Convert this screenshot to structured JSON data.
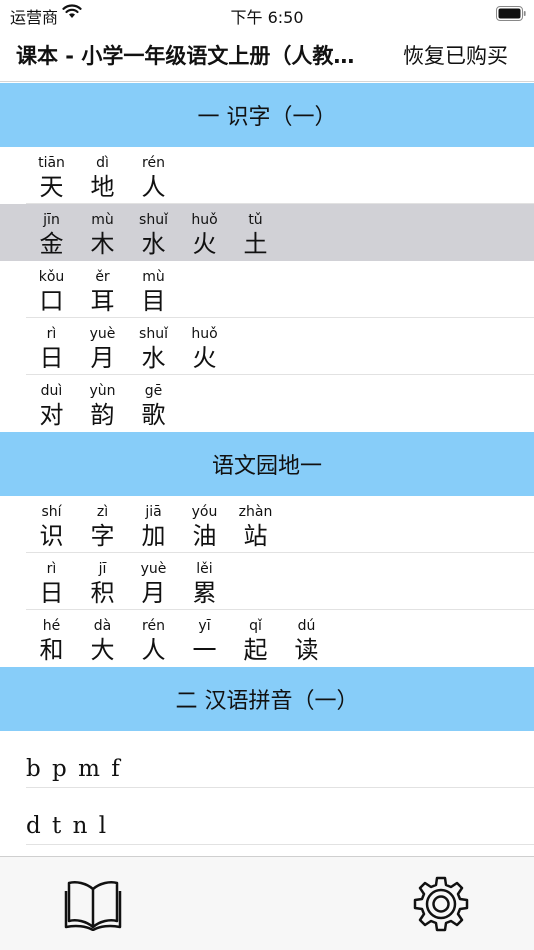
{
  "status_bar": {
    "carrier": "运营商",
    "time": "下午 6:50"
  },
  "nav": {
    "title": "课本 - 小学一年级语文上册（人教…",
    "restore_label": "恢复已购买"
  },
  "sections": [
    {
      "title": "一 识字（一）",
      "rows": [
        [
          {
            "p": "tiān",
            "c": "天"
          },
          {
            "p": "dì",
            "c": "地"
          },
          {
            "p": "rén",
            "c": "人"
          }
        ],
        [
          {
            "p": "jīn",
            "c": "金"
          },
          {
            "p": "mù",
            "c": "木"
          },
          {
            "p": "shuǐ",
            "c": "水"
          },
          {
            "p": "huǒ",
            "c": "火"
          },
          {
            "p": "tǔ",
            "c": "土"
          }
        ],
        [
          {
            "p": "kǒu",
            "c": "口"
          },
          {
            "p": "ěr",
            "c": "耳"
          },
          {
            "p": "mù",
            "c": "目"
          }
        ],
        [
          {
            "p": "rì",
            "c": "日"
          },
          {
            "p": "yuè",
            "c": "月"
          },
          {
            "p": "shuǐ",
            "c": "水"
          },
          {
            "p": "huǒ",
            "c": "火"
          }
        ],
        [
          {
            "p": "duì",
            "c": "对"
          },
          {
            "p": "yùn",
            "c": "韵"
          },
          {
            "p": "gē",
            "c": "歌"
          }
        ]
      ]
    },
    {
      "title": "语文园地一",
      "rows": [
        [
          {
            "p": "shí",
            "c": "识"
          },
          {
            "p": "zì",
            "c": "字"
          },
          {
            "p": "jiā",
            "c": "加"
          },
          {
            "p": "yóu",
            "c": "油"
          },
          {
            "p": "zhàn",
            "c": "站"
          }
        ],
        [
          {
            "p": "rì",
            "c": "日"
          },
          {
            "p": "jī",
            "c": "积"
          },
          {
            "p": "yuè",
            "c": "月"
          },
          {
            "p": "lěi",
            "c": "累"
          }
        ],
        [
          {
            "p": "hé",
            "c": "和"
          },
          {
            "p": "dà",
            "c": "大"
          },
          {
            "p": "rén",
            "c": "人"
          },
          {
            "p": "yī",
            "c": "一"
          },
          {
            "p": "qǐ",
            "c": "起"
          },
          {
            "p": "dú",
            "c": "读"
          }
        ]
      ]
    },
    {
      "title": "二 汉语拼音（一）",
      "pinyin_rows": [
        "b p m f",
        "d t n l"
      ]
    }
  ],
  "selected_row": {
    "section": 0,
    "row": 1
  },
  "icons": {
    "wifi": "wifi-icon",
    "battery": "battery-icon",
    "book": "book-icon",
    "settings": "gear-icon"
  },
  "colors": {
    "section_header": "#87cdf9",
    "selected_row": "#d1d1d6"
  }
}
